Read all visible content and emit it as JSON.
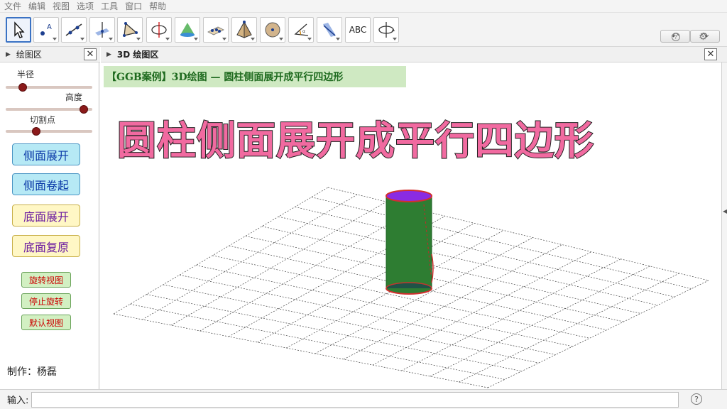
{
  "menu": [
    "文件",
    "编辑",
    "视图",
    "选项",
    "工具",
    "窗口",
    "帮助"
  ],
  "toolbar": {
    "tools": [
      "move-tool",
      "point-tool",
      "line-tool",
      "perpendicular-tool",
      "polygon-tool",
      "circle-tool",
      "cone-tool",
      "plane-tool",
      "pyramid-tool",
      "sphere-tool",
      "angle-tool",
      "reflect-tool",
      "text-tool",
      "rotate-view-tool"
    ],
    "text_tool_label": "ABC",
    "undo_icon": "↶",
    "redo_icon": "↷",
    "help_icon": "?",
    "settings_icon": "⚙"
  },
  "algebra_panel": {
    "title": "绘图区",
    "close": "✕",
    "sliders": [
      {
        "label": "半径",
        "value_fraction": 0.2
      },
      {
        "label": "高度",
        "value_fraction": 0.9
      },
      {
        "label": "切割点",
        "value_fraction": 0.35
      }
    ],
    "buttons_big": [
      "侧面展开",
      "侧面卷起",
      "底面展开",
      "底面复原"
    ],
    "buttons_small": [
      "旋转视图",
      "停止旋转",
      "默认视图"
    ],
    "maker": "制作：杨磊"
  },
  "view3d": {
    "title": "3D 绘图区",
    "close": "✕",
    "banner": "【GGB案例】3D绘图 — 圆柱侧面展开成平行四边形",
    "big_title": "圆柱侧面展开成平行四边形"
  },
  "input_bar": {
    "label": "输入:",
    "value": "",
    "help": "?"
  },
  "colors": {
    "cylinder_side": "#2e7d32",
    "cylinder_top": "#8a2be2",
    "cylinder_edge": "#d32f2f",
    "title_fill": "#f16aa0"
  }
}
